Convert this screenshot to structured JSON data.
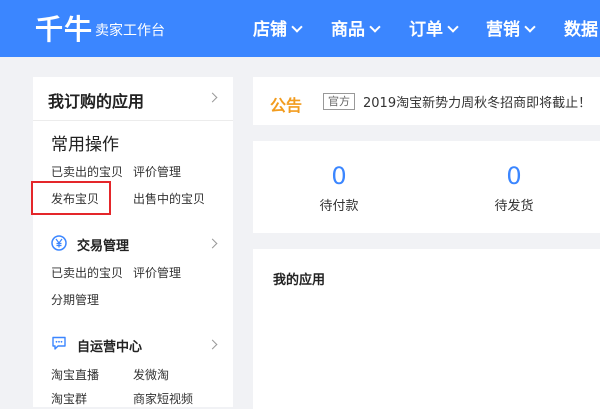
{
  "header": {
    "logo": "千牛",
    "subtitle": "卖家工作台",
    "nav": [
      "店铺",
      "商品",
      "订单",
      "营销",
      "数据"
    ]
  },
  "sidebar": {
    "title": "我订购的应用",
    "common": {
      "heading": "常用操作",
      "links": [
        "已卖出的宝贝",
        "评价管理",
        "发布宝贝",
        "出售中的宝贝"
      ]
    },
    "trade": {
      "heading": "交易管理",
      "icon": "yen-circle-icon",
      "links": [
        "已卖出的宝贝",
        "评价管理",
        "分期管理"
      ]
    },
    "self": {
      "heading": "自运营中心",
      "icon": "chat-bubble-icon",
      "links": [
        "淘宝直播",
        "发微淘",
        "淘宝群",
        "商家短视频"
      ]
    }
  },
  "notice": {
    "title": "公告",
    "tag": "官方",
    "text": "2019淘宝新势力周秋冬招商即将截止！"
  },
  "stats": [
    {
      "value": "0",
      "label": "待付款"
    },
    {
      "value": "0",
      "label": "待发货"
    }
  ],
  "apps": {
    "title": "我的应用"
  },
  "colors": {
    "brand": "#3b86ff",
    "notice": "#f29c1f",
    "highlight": "#e4262a"
  }
}
